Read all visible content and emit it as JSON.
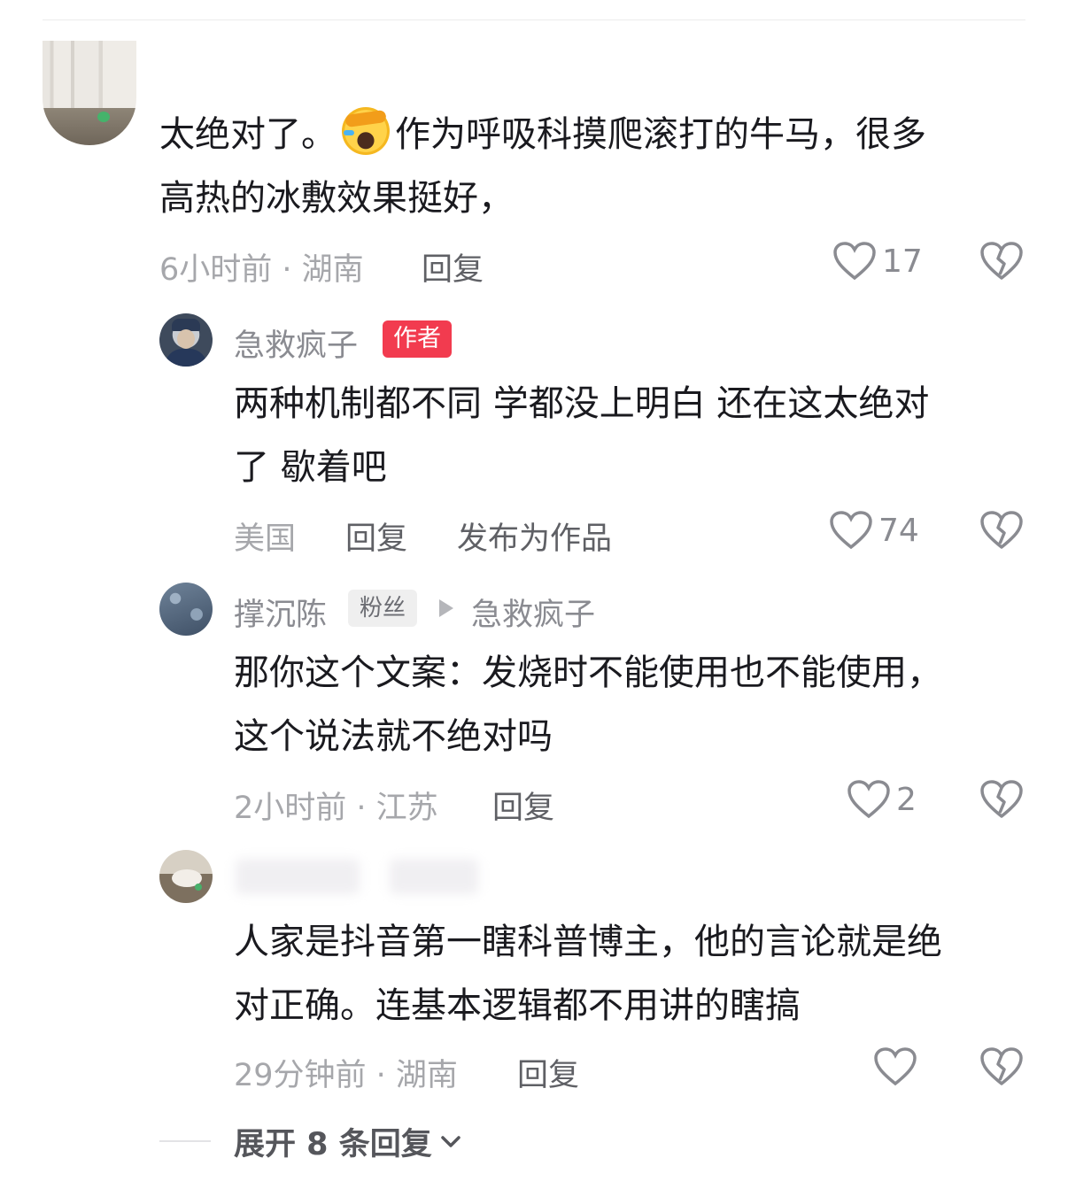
{
  "comments": [
    {
      "text_lines": [
        "太绝对了。",
        "作为呼吸科摸爬滚打的牛马，很多",
        "高热的冰敷效果挺好，"
      ],
      "emoji": "screaming-face-emoji",
      "meta": "6小时前 · 湖南",
      "reply": "回复",
      "likes": "17"
    },
    {
      "name": "急救疯子",
      "badge": "作者",
      "text_lines": [
        "两种机制都不同 学都没上明白 还在这太绝对",
        "了 歇着吧"
      ],
      "meta": "美国",
      "reply": "回复",
      "publish": "发布为作品",
      "likes": "74"
    },
    {
      "name": "撑沉陈",
      "badge": "粉丝",
      "reply_to": "急救疯子",
      "text_lines": [
        "那你这个文案：发烧时不能使用也不能使用，",
        "这个说法就不绝对吗"
      ],
      "meta": "2小时前 · 江苏",
      "reply": "回复",
      "likes": "2"
    },
    {
      "text_lines": [
        "人家是抖音第一瞎科普博主，他的言论就是绝",
        "对正确。连基本逻辑都不用讲的瞎搞"
      ],
      "meta": "29分钟前 · 湖南",
      "reply": "回复",
      "likes": ""
    }
  ],
  "expand_label": "展开 8 条回复",
  "icons": [
    "heart-icon",
    "broken-heart-icon",
    "chevron-down-icon"
  ],
  "colors": {
    "author_badge": "#f23b4f",
    "meta_gray": "#a6a7ab",
    "text": "#1a1a1f"
  }
}
